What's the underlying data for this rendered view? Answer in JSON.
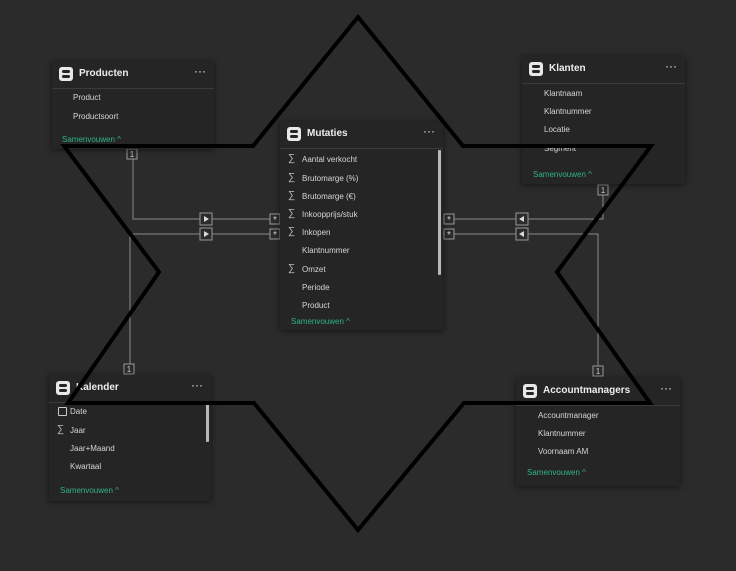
{
  "colors": {
    "background": "#2b2b2b",
    "card": "#252525",
    "accent_link": "#2fb38a",
    "relationship_line": "#8a8a8a",
    "overlay_star": "#000000"
  },
  "icons": {
    "table": "table-icon",
    "more": "more-options-icon",
    "sum": "sigma-icon",
    "date": "calendar-icon",
    "arrow": "filter-direction-icon"
  },
  "ui": {
    "more_glyph": "···",
    "sigma_glyph": "∑",
    "cardinality_one": "1",
    "cardinality_many": "*"
  },
  "tables": {
    "producten": {
      "title": "Producten",
      "fields": [
        "Product",
        "Productsoort"
      ],
      "collapse": "Samenvouwen ^"
    },
    "klanten": {
      "title": "Klanten",
      "fields": [
        "Klantnaam",
        "Klantnummer",
        "Locatie",
        "Segment"
      ],
      "collapse": "Samenvouwen ^"
    },
    "mutaties": {
      "title": "Mutaties",
      "fields": [
        "Aantal verkocht",
        "Brutomarge (%)",
        "Brutomarge (€)",
        "Inkoopprijs/stuk",
        "Inkopen",
        "Klantnummer",
        "Omzet",
        "Periode",
        "Product"
      ],
      "collapse": "Samenvouwen ^"
    },
    "kalender": {
      "title": "Kalender",
      "fields": [
        "Date",
        "Jaar",
        "Jaar+Maand",
        "Kwartaal"
      ],
      "collapse": "Samenvouwen ^"
    },
    "accountmanagers": {
      "title": "Accountmanagers",
      "fields": [
        "Accountmanager",
        "Klantnummer",
        "Voornaam AM"
      ],
      "collapse": "Samenvouwen ^"
    }
  }
}
